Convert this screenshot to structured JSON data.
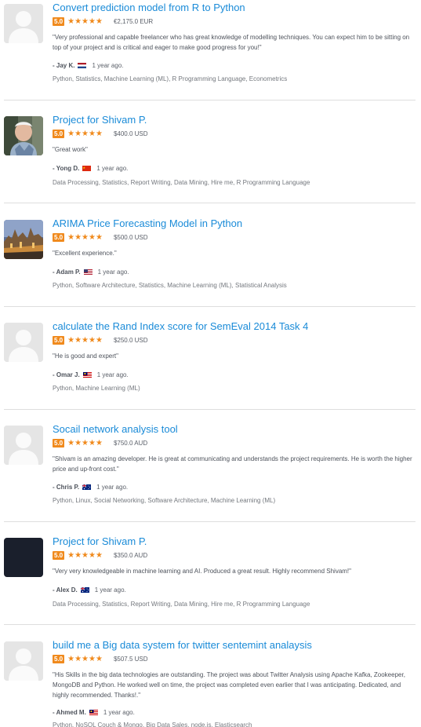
{
  "reviews": [
    {
      "title": "Convert prediction model from R to Python",
      "rating": "5.0",
      "stars": "★★★★★",
      "amount": "€2,175.0 EUR",
      "comment": "\"Very professional and capable freelancer who has great knowledge of modelling techniques. You can expect him to be sitting on top of your project and is critical and eager to make good progress for you!\"",
      "reviewer": "- Jay K.",
      "flag": "nl-flag-icon",
      "time": "1 year ago.",
      "skills": "Python, Statistics, Machine Learning (ML), R Programming Language, Econometrics"
    },
    {
      "title": "Project for Shivam P.",
      "rating": "5.0",
      "stars": "★★★★★",
      "amount": "$400.0 USD",
      "comment": "\"Great work\"",
      "reviewer": "- Yong D.",
      "flag": "cn-flag-icon",
      "time": "1 year ago.",
      "skills": "Data Processing, Statistics, Report Writing, Data Mining, Hire me, R Programming Language"
    },
    {
      "title": "ARIMA Price Forecasting Model in Python",
      "rating": "5.0",
      "stars": "★★★★★",
      "amount": "$500.0 USD",
      "comment": "\"Excellent experience.\"",
      "reviewer": "- Adam P.",
      "flag": "us-flag-icon",
      "time": "1 year ago.",
      "skills": "Python, Software Architecture, Statistics, Machine Learning (ML), Statistical Analysis"
    },
    {
      "title": "calculate the Rand Index score for SemEval 2014 Task 4",
      "rating": "5.0",
      "stars": "★★★★★",
      "amount": "$250.0 USD",
      "comment": "\"He is good and expert\"",
      "reviewer": "- Omar J.",
      "flag": "my-flag-icon",
      "time": "1 year ago.",
      "skills": "Python, Machine Learning (ML)"
    },
    {
      "title": "Socail network analysis tool",
      "rating": "5.0",
      "stars": "★★★★★",
      "amount": "$750.0 AUD",
      "comment": "\"Shivam is an amazing developer. He is great at communicating and understands the project requirements. He is worth the higher price and up-front cost.\"",
      "reviewer": "- Chris P.",
      "flag": "au-flag-icon",
      "time": "1 year ago.",
      "skills": "Python, Linux, Social Networking, Software Architecture, Machine Learning (ML)"
    },
    {
      "title": "Project for Shivam P.",
      "rating": "5.0",
      "stars": "★★★★★",
      "amount": "$350.0 AUD",
      "comment": "\"Very very knowledgeable in machine learning and AI. Produced a great result. Highly recommend Shivam!\"",
      "reviewer": "- Alex D.",
      "flag": "au-flag-icon",
      "time": "1 year ago.",
      "skills": "Data Processing, Statistics, Report Writing, Data Mining, Hire me, R Programming Language"
    },
    {
      "title": "build me a Big data system for twitter sentemint analaysis",
      "rating": "5.0",
      "stars": "★★★★★",
      "amount": "$507.5 USD",
      "comment": "\"His Skills in the big data technologies are outstanding. The project was about Twitter Analysis using Apache Kafka, Zookeeper, MongoDB and Python. He worked well on time, the project was completed even earlier that I was anticipating. Dedicated, and highly recommended. Thanks!.\"",
      "reviewer": "- Ahmed M.",
      "flag": "my-flag-icon",
      "time": "1 year ago.",
      "skills": "Python, NoSQL Couch & Mongo, Big Data Sales, node.js, Elasticsearch"
    }
  ],
  "colors": {
    "title_link": "#1a8bd8",
    "rating_orange": "#f08a1d",
    "divider": "#dedede"
  }
}
